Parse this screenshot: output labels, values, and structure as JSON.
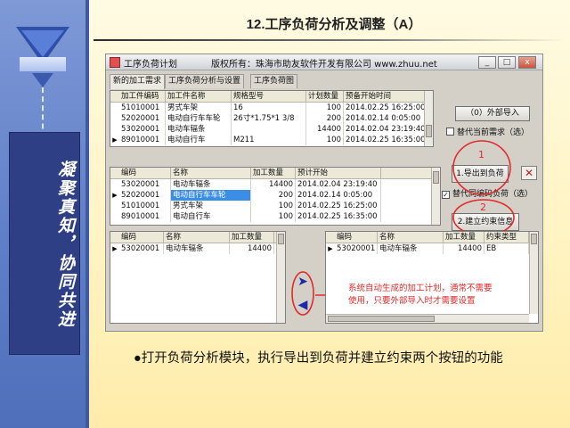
{
  "slide": {
    "title": "12.工序负荷分析及调整（A）",
    "motto": "凝聚真知，协同共进",
    "bullet": "●打开负荷分析模块，执行导出到负荷并建立约束两个按钮的功能"
  },
  "window": {
    "title": "工序负荷计划",
    "copyright": "版权所有：珠海市助友软件开发有限公司 www.zhuu.net",
    "controls": {
      "minimize": "_",
      "maximize": "□",
      "close": "x"
    }
  },
  "tabs": [
    "新的加工需求",
    "工序负荷分析与设置",
    "工序负荷图"
  ],
  "demand_table": {
    "columns": [
      "加工件编码",
      "加工件名称",
      "规格型号",
      "计划数量",
      "预备开始时间"
    ],
    "rows": [
      [
        "51010001",
        "男式车架",
        "16",
        "100",
        "2014.02.25 16:25:00"
      ],
      [
        "52020001",
        "电动自行车车轮",
        "26寸*1.75*1 3/8",
        "200",
        "2014.02.14 0:05:00"
      ],
      [
        "53020001",
        "电动车辐条",
        "",
        "14400",
        "2014.02.04 23:19:40"
      ],
      [
        "89010001",
        "电动自行车",
        "M211",
        "100",
        "2014.02.25 16:35:00"
      ]
    ],
    "selected_row": 3
  },
  "load_table": {
    "columns": [
      "编码",
      "名称",
      "加工数量",
      "预计开始"
    ],
    "rows": [
      [
        "53020001",
        "电动车辐条",
        "14400",
        "2014.02.04 23:19:40"
      ],
      [
        "52020001",
        "电动自行车车轮",
        "200",
        "2014.02.14 0:05:00"
      ],
      [
        "51010001",
        "男式车架",
        "100",
        "2014.02.25 16:25:00"
      ],
      [
        "89010001",
        "电动自行车",
        "100",
        "2014.02.25 16:35:00"
      ]
    ],
    "selected_row": 1
  },
  "bottom_left_table": {
    "columns": [
      "编码",
      "名称",
      "加工数量"
    ],
    "rows": [
      [
        "53020001",
        "电动车辐条",
        "14400"
      ]
    ]
  },
  "bottom_right_table": {
    "columns": [
      "编码",
      "名称",
      "加工数量",
      "约束类型"
    ],
    "rows": [
      [
        "53020001",
        "电动车辐条",
        "14400",
        "EB"
      ]
    ]
  },
  "buttons": {
    "external_import": "（0）外部导入",
    "export_to_load": "1.导出到负荷",
    "create_constraint": "2.建立约束信息",
    "delete": "✕"
  },
  "checkboxes": {
    "replace_demand": {
      "label": "替代当前需求（选）",
      "checked": false
    },
    "replace_same_code": {
      "label": "替代同编码负荷（选）",
      "checked": true
    }
  },
  "annotations": {
    "mark1": "1",
    "mark2": "2",
    "note_line1": "系统自动生成的加工计划，通常不需要",
    "note_line2": "使用，只要外部导入时才需要设置"
  },
  "arrows": {
    "right": "➤",
    "left": "◀"
  },
  "colors": {
    "selection": "#3a8ee6",
    "annotation": "#e12a2a",
    "sidebar": "#5f7fc8"
  }
}
